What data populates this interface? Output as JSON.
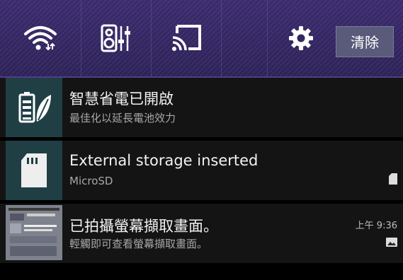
{
  "quick_settings": {
    "wifi_icon": "wifi-icon",
    "audio_icon": "audio-equalizer-icon",
    "cast_icon": "cast-screen-icon",
    "settings_icon": "gear-icon",
    "clear_label": "清除"
  },
  "notifications": [
    {
      "icon": "battery-leaf-icon",
      "title": "智慧省電已開啟",
      "subtitle": "最佳化以延長電池效力"
    },
    {
      "icon": "sd-card-icon",
      "title": "External storage inserted",
      "subtitle": "MicroSD",
      "small_icon": "sd-card-small-icon"
    },
    {
      "icon": "screenshot-thumbnail",
      "title": "已拍攝螢幕擷取畫面。",
      "subtitle": "輕觸即可查看螢幕擷取畫面。",
      "time": "上午 9:36",
      "small_icon": "image-small-icon"
    }
  ],
  "colors": {
    "quick_settings_bg": "#3b2a6e",
    "notification_bg": "#141414",
    "icon_tile_bg": "#1f3f45"
  }
}
